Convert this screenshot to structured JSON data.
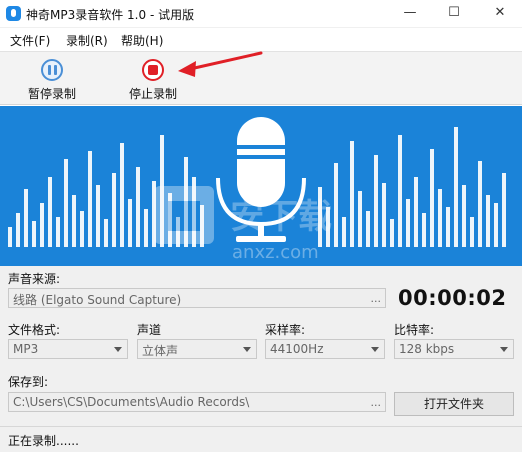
{
  "window": {
    "title": "神奇MP3录音软件 1.0 - 试用版",
    "minimize_glyph": "—",
    "maximize_glyph": "☐",
    "close_glyph": "✕"
  },
  "menu": [
    "文件(F)",
    "录制(R)",
    "帮助(H)"
  ],
  "toolbar": {
    "pause_label": "暂停录制",
    "stop_label": "停止录制"
  },
  "watermark": {
    "text": "安下载",
    "url": "anxz.com"
  },
  "source": {
    "label": "声音来源:",
    "value": "线路 (Elgato Sound Capture)",
    "browse": "..."
  },
  "timer": "00:00:02",
  "format": {
    "label": "文件格式:",
    "value": "MP3"
  },
  "channel": {
    "label": "声道",
    "value": "立体声"
  },
  "samplerate": {
    "label": "采样率:",
    "value": "44100Hz"
  },
  "bitrate": {
    "label": "比特率:",
    "value": "128 kbps"
  },
  "save": {
    "label": "保存到:",
    "path": "C:\\Users\\CS\\Documents\\Audio Records\\",
    "browse": "...",
    "open_folder": "打开文件夹"
  },
  "status": "正在录制......",
  "colors": {
    "visual_bg": "#1b83d8",
    "stop_red": "#e01f26",
    "pause_blue": "#4a8fd6",
    "arrow_red": "#e01f26"
  }
}
